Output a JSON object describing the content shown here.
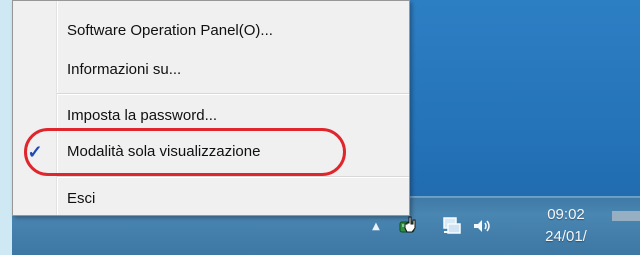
{
  "context_menu": {
    "items": [
      {
        "label": "Software Operation Panel(O)...",
        "checked": false
      },
      {
        "label": "Informazioni su...",
        "checked": false
      },
      {
        "label": "Imposta la password...",
        "checked": false
      },
      {
        "label": "Modalità sola visualizzazione",
        "checked": true
      },
      {
        "label": "Esci",
        "checked": false
      }
    ],
    "check_glyph": "✓"
  },
  "taskbar": {
    "tray_icons": [
      "show-hidden-icons-arrow",
      "scanner-icon",
      "network-icon",
      "volume-icon"
    ],
    "clock": {
      "time": "09:02",
      "date": "24/01/"
    }
  },
  "colors": {
    "accent_highlight": "#e0262d",
    "checkmark": "#1f48b8",
    "desktop": "#2472b8",
    "taskbar": "#3f79a6"
  }
}
